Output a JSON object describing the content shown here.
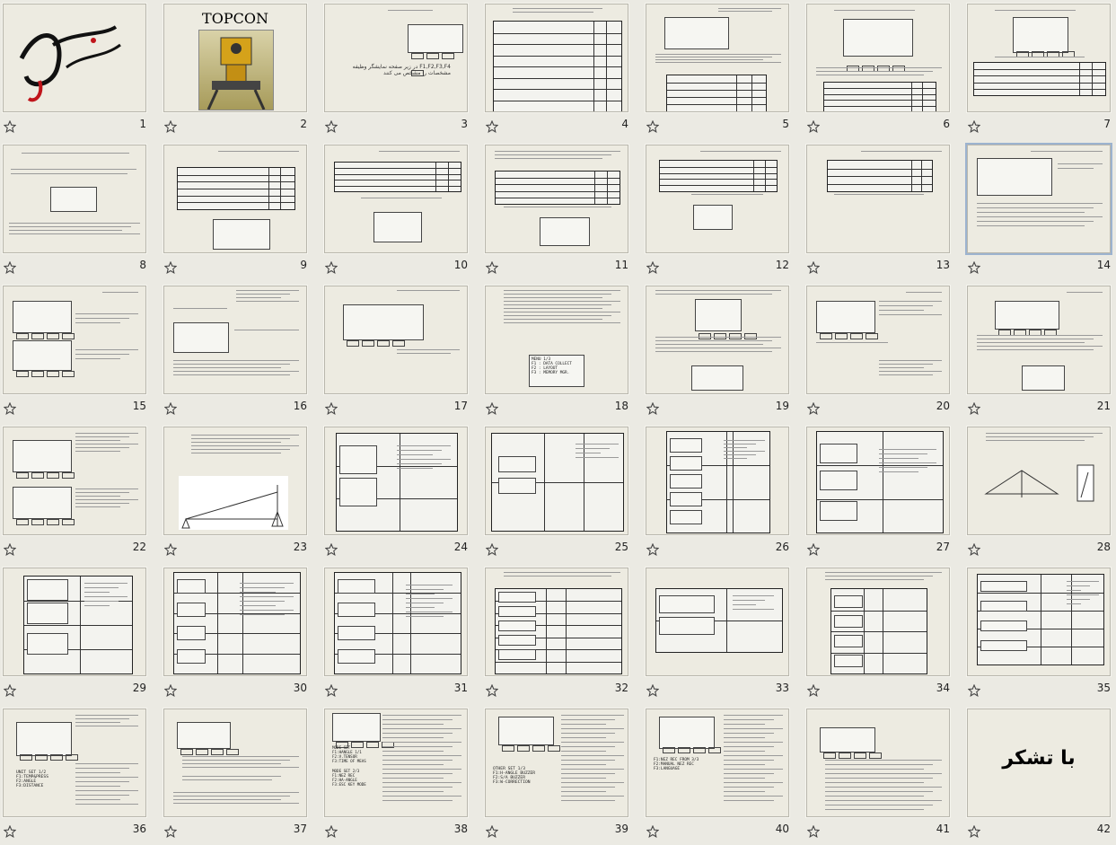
{
  "slides": [
    {
      "n": "1"
    },
    {
      "n": "2"
    },
    {
      "n": "3"
    },
    {
      "n": "4"
    },
    {
      "n": "5"
    },
    {
      "n": "6"
    },
    {
      "n": "7"
    },
    {
      "n": "8"
    },
    {
      "n": "9"
    },
    {
      "n": "10"
    },
    {
      "n": "11"
    },
    {
      "n": "12"
    },
    {
      "n": "13"
    },
    {
      "n": "14"
    },
    {
      "n": "15"
    },
    {
      "n": "16"
    },
    {
      "n": "17"
    },
    {
      "n": "18"
    },
    {
      "n": "19"
    },
    {
      "n": "20"
    },
    {
      "n": "21"
    },
    {
      "n": "22"
    },
    {
      "n": "23"
    },
    {
      "n": "24"
    },
    {
      "n": "25"
    },
    {
      "n": "26"
    },
    {
      "n": "27"
    },
    {
      "n": "28"
    },
    {
      "n": "29"
    },
    {
      "n": "30"
    },
    {
      "n": "31"
    },
    {
      "n": "32"
    },
    {
      "n": "33"
    },
    {
      "n": "34"
    },
    {
      "n": "35"
    },
    {
      "n": "36"
    },
    {
      "n": "37"
    },
    {
      "n": "38"
    },
    {
      "n": "39"
    },
    {
      "n": "40"
    },
    {
      "n": "41"
    },
    {
      "n": "42"
    }
  ],
  "slide2": {
    "title": "TOPCON"
  },
  "slide3": {
    "text": "F1,F2,F3,F4 در زیر صفحه نمایشگر وظیفه مشخصات را مشخص می کنند"
  },
  "slide18": {
    "menu": "MENU 1/3\nF1 : DATA COLLECT\nF2 : LAYOUT\nF3 : MEMORY MGR."
  },
  "slide36": {
    "unit": "UNIT SET 1/2\nF1:TEMP&PRESS\nF2:ANGLE\nF3:DISTANCE"
  },
  "slide38": {
    "mode1": "MODE SET\nF1:HANGLE 1/1\nF2:V.TENSOR\nF3:TIME OF MEAS",
    "mode2": "MODE SET 2/3\nF1:NEZ REC\nF2:HA-ANGLE\nF3:ESC KEY MODE"
  },
  "slide39": {
    "other": "OTHER SET 1/3\nF1:H-ANGLE BUZZER\nF2:S/A BUZZER\nF3:W-CORRECTION"
  },
  "slide40": {
    "rec": "F1:NEZ REC FROM 3/3\nF2:MANUAL NEZ REC\nF3:LANGUAGE"
  },
  "slide42": {
    "thanks": "با تشکر"
  }
}
